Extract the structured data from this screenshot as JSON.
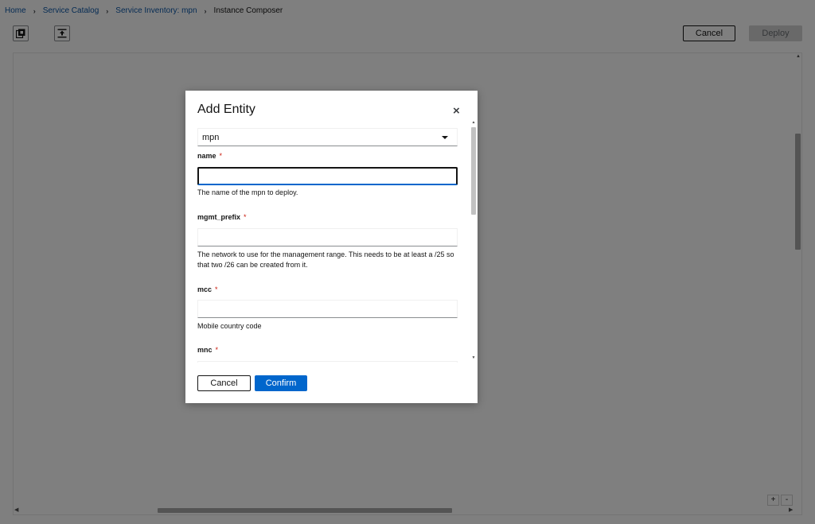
{
  "breadcrumb": {
    "home": "Home",
    "catalog": "Service Catalog",
    "inventory": "Service Inventory: mpn",
    "current": "Instance Composer",
    "separator": "›"
  },
  "toolbar": {
    "icon1": "copy-icon",
    "icon2": "export-icon",
    "cancel_label": "Cancel",
    "deploy_label": "Deploy"
  },
  "canvas": {
    "zoom_in": "+",
    "zoom_out": "-"
  },
  "modal": {
    "title": "Add Entity",
    "close": "×",
    "entity_type": "mpn",
    "fields": [
      {
        "label": "name",
        "required": "*",
        "value": "",
        "helper": "The name of the mpn to deploy."
      },
      {
        "label": "mgmt_prefix",
        "required": "*",
        "value": "",
        "helper": "The network to use for the management range. This needs to be at least a /25 so that two /26 can be created from it."
      },
      {
        "label": "mcc",
        "required": "*",
        "value": "",
        "helper": "Mobile country code"
      },
      {
        "label": "mnc",
        "required": "*",
        "value": "",
        "helper": ""
      }
    ],
    "cancel_label": "Cancel",
    "confirm_label": "Confirm"
  },
  "colors": {
    "primary": "#0066cc",
    "link": "#0b57a8",
    "required": "#c9190b",
    "overlay": "rgba(0,0,0,0.5)"
  }
}
